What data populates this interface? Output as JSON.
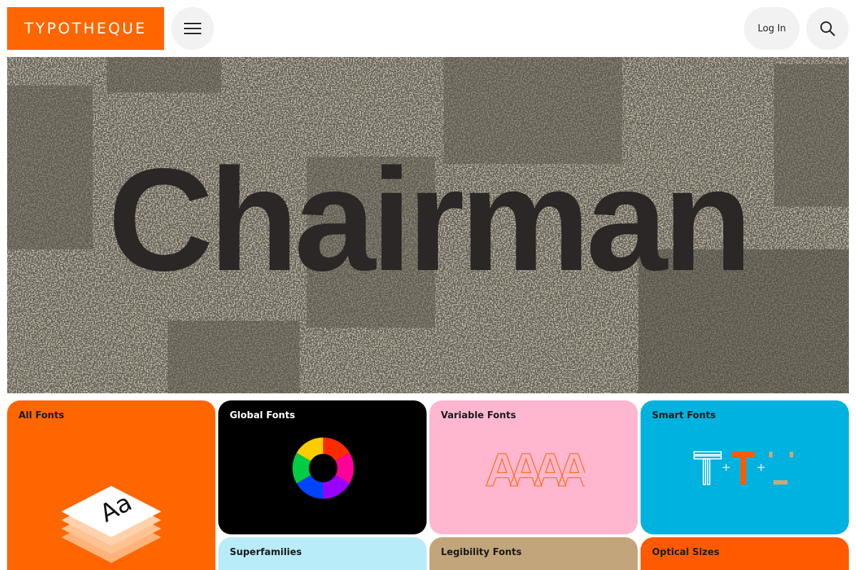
{
  "header": {
    "logo": "TYPOTHEQUE",
    "login_label": "Log In"
  },
  "hero": {
    "title": "Chairman"
  },
  "cards": {
    "all_fonts": "All Fonts",
    "all_fonts_glyph": "Aa",
    "global_fonts": "Global Fonts",
    "variable_fonts": "Variable Fonts",
    "variable_glyph": "AAAA",
    "smart_fonts": "Smart Fonts",
    "superfamilies": "Superfamilies",
    "legibility_fonts": "Legibility Fonts",
    "optical_sizes": "Optical Sizes"
  },
  "colors": {
    "brand_orange": "#ff6600",
    "global_bg": "#000000",
    "variable_bg": "#ffb6cf",
    "smart_bg": "#00b2df",
    "super_bg": "#b8ecf8",
    "legibility_bg": "#c2a57a",
    "optical_bg": "#ff5a00"
  }
}
